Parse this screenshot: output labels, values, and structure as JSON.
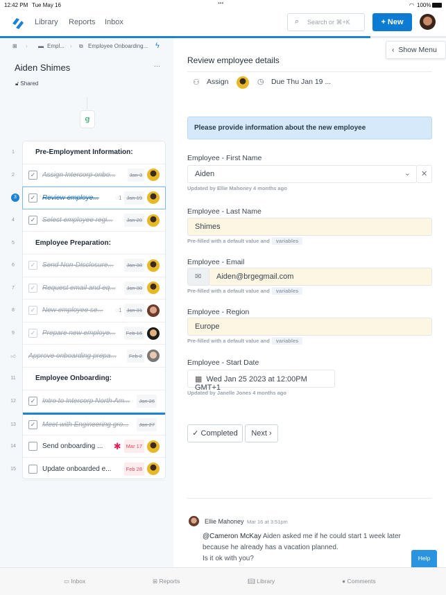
{
  "status_bar": {
    "time": "12:42 PM",
    "date": "Tue May 16",
    "battery": "100%"
  },
  "nav": {
    "links": [
      "Library",
      "Reports",
      "Inbox"
    ],
    "search_placeholder": "Search or ⌘+K",
    "new_label": "+ New"
  },
  "progress_percent": 83,
  "breadcrumb": {
    "folder": "Empl...",
    "workflow": "Employee Onboarding..."
  },
  "run": {
    "title": "Aiden Shimes",
    "shared": "Shared",
    "more": "···"
  },
  "tasks": [
    {
      "n": "1",
      "type": "header",
      "title": "Pre-Employment Information:"
    },
    {
      "n": "2",
      "title": "Assign Intercorp onbo...",
      "date": "Jan 3",
      "done": true
    },
    {
      "n": "3",
      "title": "Review employe...",
      "date": "Jan 19",
      "comments": "1",
      "done": true,
      "selected": true
    },
    {
      "n": "4",
      "title": "Select employee regi...",
      "date": "Jan 20",
      "done": true
    },
    {
      "n": "5",
      "type": "header",
      "title": "Employee Preparation:"
    },
    {
      "n": "6",
      "title": "Send Non-Disclosure...",
      "date": "Jan 30",
      "done": true
    },
    {
      "n": "7",
      "title": "Request email and eq...",
      "date": "Jan 30",
      "done": true
    },
    {
      "n": "8",
      "title": "New employee se...",
      "date": "Jan 31",
      "comments": "1",
      "done": true
    },
    {
      "n": "9",
      "title": "Prepare new employe...",
      "date": "Feb 16",
      "done": true
    },
    {
      "n": "",
      "title": "Approve onboarding prepa...",
      "date": "Feb 2",
      "done": true,
      "approval": true
    },
    {
      "n": "11",
      "type": "header",
      "title": "Employee Onboarding:"
    },
    {
      "n": "12",
      "title": "Intro to Intercorp North Am...",
      "date": "Jan 26",
      "done": true,
      "noavatar": true
    },
    {
      "n": "13",
      "title": "Meet with Engineering gro...",
      "date": "Jan 27",
      "done": true,
      "noavatar": true
    },
    {
      "n": "14",
      "title": "Send onboarding ...",
      "date": "Mar 17",
      "done": false,
      "overdue": true,
      "slack": true
    },
    {
      "n": "15",
      "title": "Update onboarded e...",
      "date": "Feb 28",
      "done": false,
      "overdue": true
    }
  ],
  "detail": {
    "show_menu": "Show Menu",
    "title": "Review employee details",
    "assign": "Assign",
    "due": "Due Thu Jan 19 ...",
    "banner": "Please provide information about the new employee",
    "fields": [
      {
        "label": "Employee - First Name",
        "value": "Aiden",
        "help": "Updated by Ellie Mahoney 4 months ago"
      },
      {
        "label": "Employee - Last Name",
        "value": "Shimes",
        "help": "Pre-filled with a default value and",
        "tag": "variables"
      },
      {
        "label": "Employee - Email",
        "value": "Aiden@brgegmail.com",
        "help": "Pre-filled with a default value and",
        "tag": "variables"
      },
      {
        "label": "Employee - Region",
        "value": "Europe",
        "help": "Pre-filled with a default value and",
        "tag": "variables"
      },
      {
        "label": "Employee - Start Date",
        "value": "Wed Jan 25 2023 at 12:00PM GMT+1",
        "help": "Updated by Janelle Jones 4 months ago"
      }
    ],
    "completed": "✓ Completed",
    "next": "Next ›"
  },
  "comment": {
    "author": "Ellie Mahoney",
    "time": "Mar 16 at 3:51pm",
    "mention": "@Cameron McKay",
    "text": " Aiden asked me if he could start 1 week later because he already has a vacation planned.",
    "text2": "Is it ok with you?"
  },
  "help": "Help",
  "tabbar": [
    "Inbox",
    "Reports",
    "Library",
    "Comments"
  ],
  "colors": {
    "accent": "#0c7bd3",
    "prefilled": "#fdf6e3",
    "banner": "#d6e9fb",
    "overdue": "#e0475b"
  }
}
